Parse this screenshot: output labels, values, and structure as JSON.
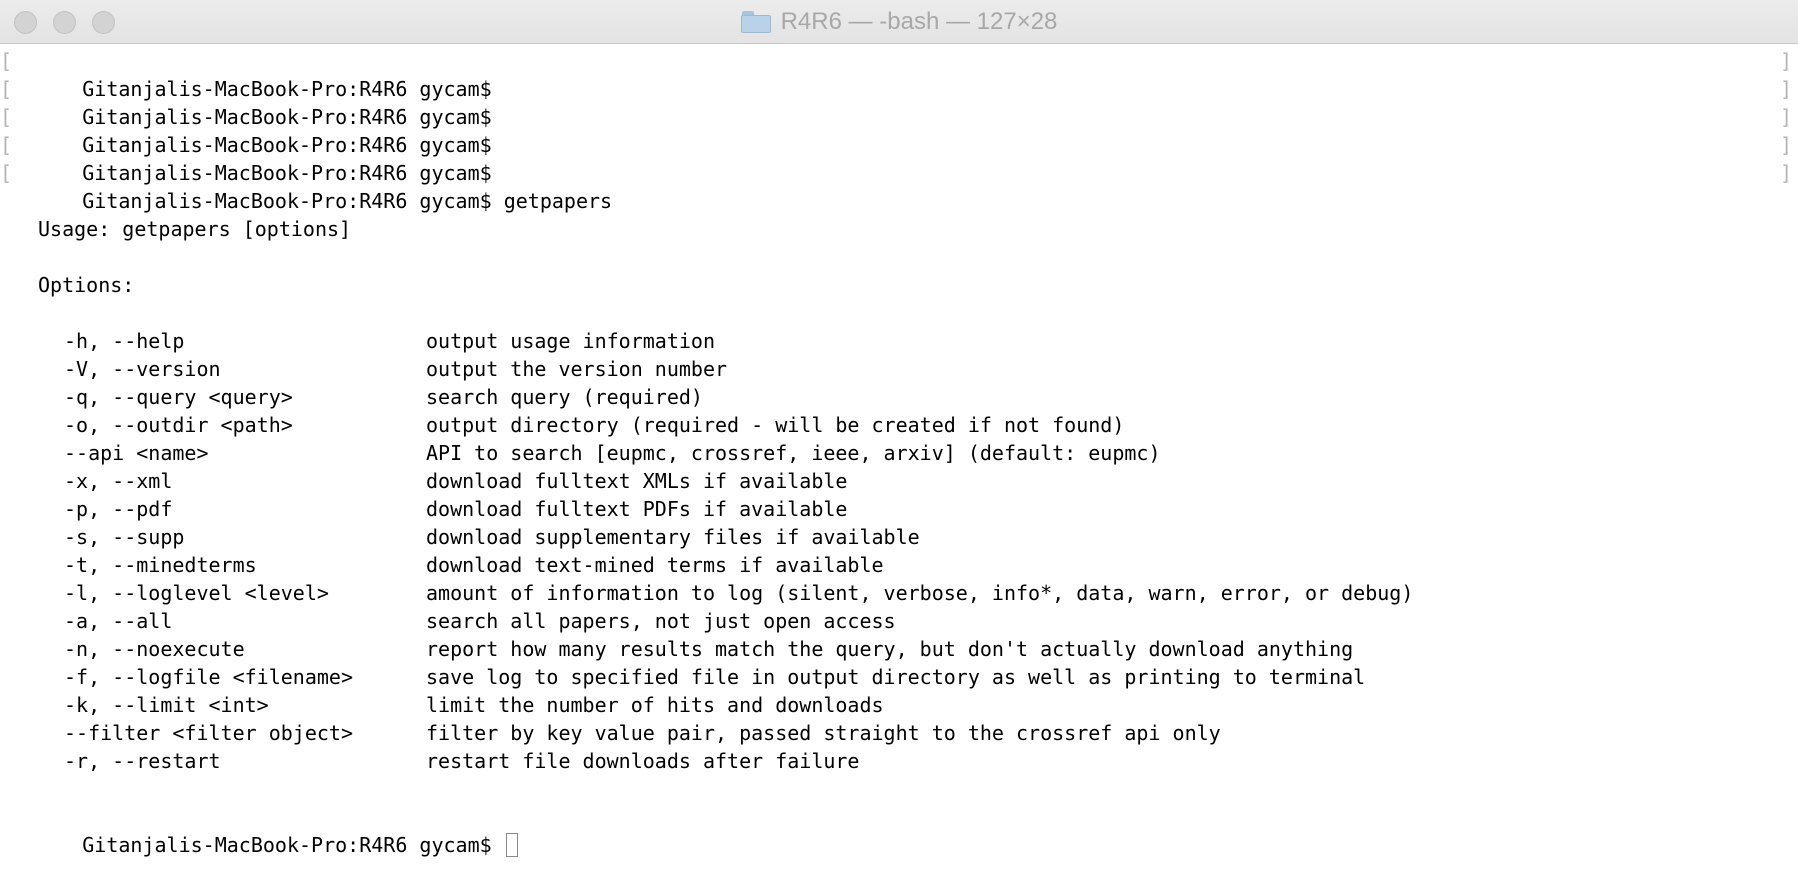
{
  "window": {
    "title": "R4R6 — -bash — 127×28",
    "folder_icon": "folder-icon"
  },
  "terminal": {
    "prompt": "Gitanjalis-MacBook-Pro:R4R6 gycam$",
    "history": [
      {
        "prompt": "Gitanjalis-MacBook-Pro:R4R6 gycam$",
        "command": ""
      },
      {
        "prompt": "Gitanjalis-MacBook-Pro:R4R6 gycam$",
        "command": ""
      },
      {
        "prompt": "Gitanjalis-MacBook-Pro:R4R6 gycam$",
        "command": ""
      },
      {
        "prompt": "Gitanjalis-MacBook-Pro:R4R6 gycam$",
        "command": ""
      },
      {
        "prompt": "Gitanjalis-MacBook-Pro:R4R6 gycam$",
        "command": "getpapers"
      }
    ],
    "usage": "Usage: getpapers [options]",
    "options_heading": "Options:",
    "options": [
      {
        "flag": "-h, --help",
        "desc": "output usage information"
      },
      {
        "flag": "-V, --version",
        "desc": "output the version number"
      },
      {
        "flag": "-q, --query <query>",
        "desc": "search query (required)"
      },
      {
        "flag": "-o, --outdir <path>",
        "desc": "output directory (required - will be created if not found)"
      },
      {
        "flag": "--api <name>",
        "desc": "API to search [eupmc, crossref, ieee, arxiv] (default: eupmc)"
      },
      {
        "flag": "-x, --xml",
        "desc": "download fulltext XMLs if available"
      },
      {
        "flag": "-p, --pdf",
        "desc": "download fulltext PDFs if available"
      },
      {
        "flag": "-s, --supp",
        "desc": "download supplementary files if available"
      },
      {
        "flag": "-t, --minedterms",
        "desc": "download text-mined terms if available"
      },
      {
        "flag": "-l, --loglevel <level>",
        "desc": "amount of information to log (silent, verbose, info*, data, warn, error, or debug)"
      },
      {
        "flag": "-a, --all",
        "desc": "search all papers, not just open access"
      },
      {
        "flag": "-n, --noexecute",
        "desc": "report how many results match the query, but don't actually download anything"
      },
      {
        "flag": "-f, --logfile <filename>",
        "desc": "save log to specified file in output directory as well as printing to terminal"
      },
      {
        "flag": "-k, --limit <int>",
        "desc": "limit the number of hits and downloads"
      },
      {
        "flag": "--filter <filter object>",
        "desc": "filter by key value pair, passed straight to the crossref api only"
      },
      {
        "flag": "-r, --restart",
        "desc": "restart file downloads after failure"
      }
    ],
    "final_prompt": "Gitanjalis-MacBook-Pro:R4R6 gycam$"
  }
}
